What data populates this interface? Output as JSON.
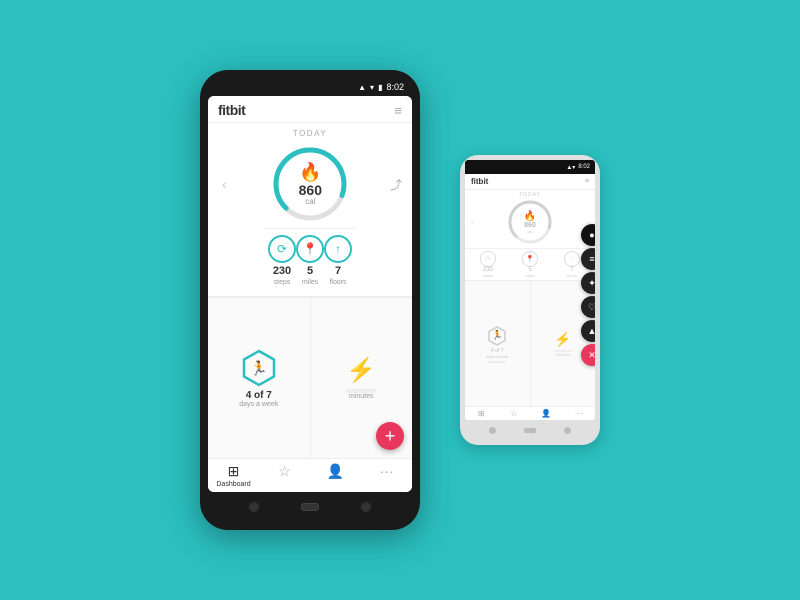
{
  "background_color": "#2bbfbf",
  "phone_large": {
    "status_bar": {
      "time": "8:02",
      "signal": "▲▼",
      "wifi": "wifi",
      "battery": "battery"
    },
    "app": {
      "logo": "fitbit",
      "today_label": "TODAY",
      "calories": {
        "value": "860",
        "unit": "cal",
        "icon": "🔥"
      },
      "stats": [
        {
          "icon": "🔄",
          "value": "230",
          "label": "steps"
        },
        {
          "icon": "📍",
          "value": "5",
          "label": "miles"
        },
        {
          "icon": "📊",
          "value": "7",
          "label": "floors"
        }
      ],
      "goals": [
        {
          "icon": "🏃",
          "value": "4 of 7",
          "label": "days a week"
        },
        {
          "icon": "⚡",
          "value": "",
          "label": "minutes"
        }
      ]
    },
    "bottom_nav": [
      {
        "label": "Dashboard",
        "active": true
      },
      {
        "label": ""
      },
      {
        "label": ""
      },
      {
        "label": ""
      }
    ],
    "fab_label": "+"
  },
  "phone_small": {
    "status_bar": {
      "time": "8:02"
    },
    "context_menu_items": [
      "●",
      "≡",
      "✦",
      "♡",
      "▲",
      "✕"
    ],
    "calories": {
      "value": "860",
      "unit": "cal"
    },
    "goals": [
      {
        "value": "4 of 7",
        "label": "days a week"
      },
      {
        "value": "",
        "label": "minutes"
      }
    ]
  }
}
